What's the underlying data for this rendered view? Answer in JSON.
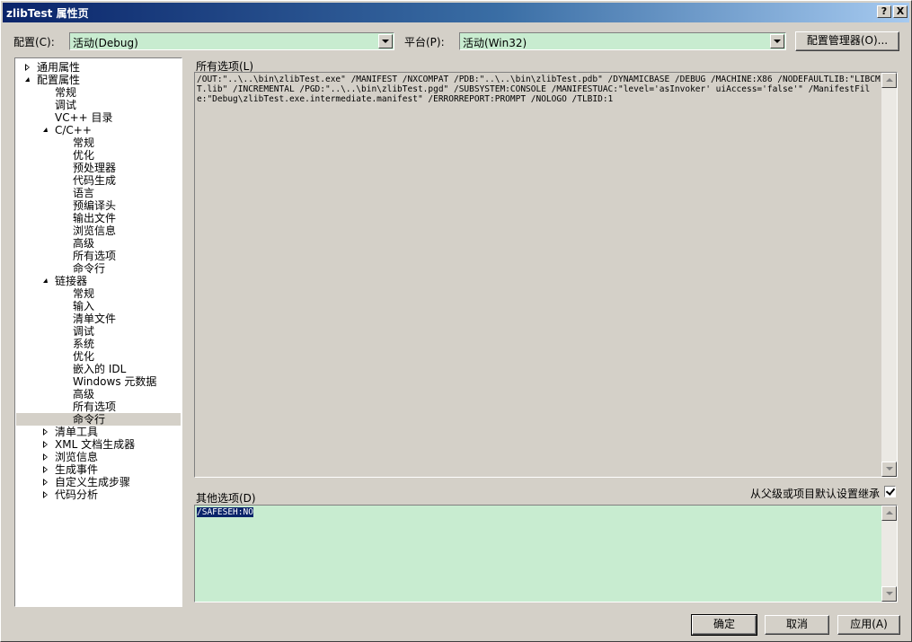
{
  "window": {
    "title": "zlibTest 属性页",
    "help_label": "?",
    "close_label": "X"
  },
  "config": {
    "label": "配置(C):",
    "value": "活动(Debug)",
    "platform_label": "平台(P):",
    "platform_value": "活动(Win32)",
    "manager_button": "配置管理器(O)..."
  },
  "tree": {
    "items": [
      {
        "label": "通用属性",
        "expander": "collapsed"
      },
      {
        "label": "配置属性",
        "expander": "expanded"
      },
      {
        "label": "常规"
      },
      {
        "label": "调试"
      },
      {
        "label": "VC++ 目录"
      },
      {
        "label": "C/C++",
        "expander": "expanded"
      },
      {
        "label": "常规"
      },
      {
        "label": "优化"
      },
      {
        "label": "预处理器"
      },
      {
        "label": "代码生成"
      },
      {
        "label": "语言"
      },
      {
        "label": "预编译头"
      },
      {
        "label": "输出文件"
      },
      {
        "label": "浏览信息"
      },
      {
        "label": "高级"
      },
      {
        "label": "所有选项"
      },
      {
        "label": "命令行"
      },
      {
        "label": "链接器",
        "expander": "expanded"
      },
      {
        "label": "常规"
      },
      {
        "label": "输入"
      },
      {
        "label": "清单文件"
      },
      {
        "label": "调试"
      },
      {
        "label": "系统"
      },
      {
        "label": "优化"
      },
      {
        "label": "嵌入的 IDL"
      },
      {
        "label": "Windows 元数据"
      },
      {
        "label": "高级"
      },
      {
        "label": "所有选项"
      },
      {
        "label": "命令行",
        "selected": true
      },
      {
        "label": "清单工具",
        "expander": "collapsed"
      },
      {
        "label": "XML 文档生成器",
        "expander": "collapsed"
      },
      {
        "label": "浏览信息",
        "expander": "collapsed"
      },
      {
        "label": "生成事件",
        "expander": "collapsed"
      },
      {
        "label": "自定义生成步骤",
        "expander": "collapsed"
      },
      {
        "label": "代码分析",
        "expander": "collapsed"
      }
    ]
  },
  "all_options": {
    "label": "所有选项(L)",
    "text": "/OUT:\"..\\..\\bin\\zlibTest.exe\" /MANIFEST /NXCOMPAT /PDB:\"..\\..\\bin\\zlibTest.pdb\" /DYNAMICBASE /DEBUG /MACHINE:X86 /NODEFAULTLIB:\"LIBCMT.lib\" /INCREMENTAL /PGD:\"..\\..\\bin\\zlibTest.pgd\" /SUBSYSTEM:CONSOLE /MANIFESTUAC:\"level='asInvoker' uiAccess='false'\" /ManifestFile:\"Debug\\zlibTest.exe.intermediate.manifest\" /ERRORREPORT:PROMPT /NOLOGO /TLBID:1"
  },
  "other_options": {
    "label": "其他选项(D)",
    "inherit_label": "从父级或项目默认设置继承",
    "inherit_checked": true,
    "text": "/SAFESEH:NO"
  },
  "buttons": {
    "ok": "确定",
    "cancel": "取消",
    "apply": "应用(A)"
  },
  "colors": {
    "field_bg": "#c8ecd0",
    "selection": "#0a246a"
  }
}
